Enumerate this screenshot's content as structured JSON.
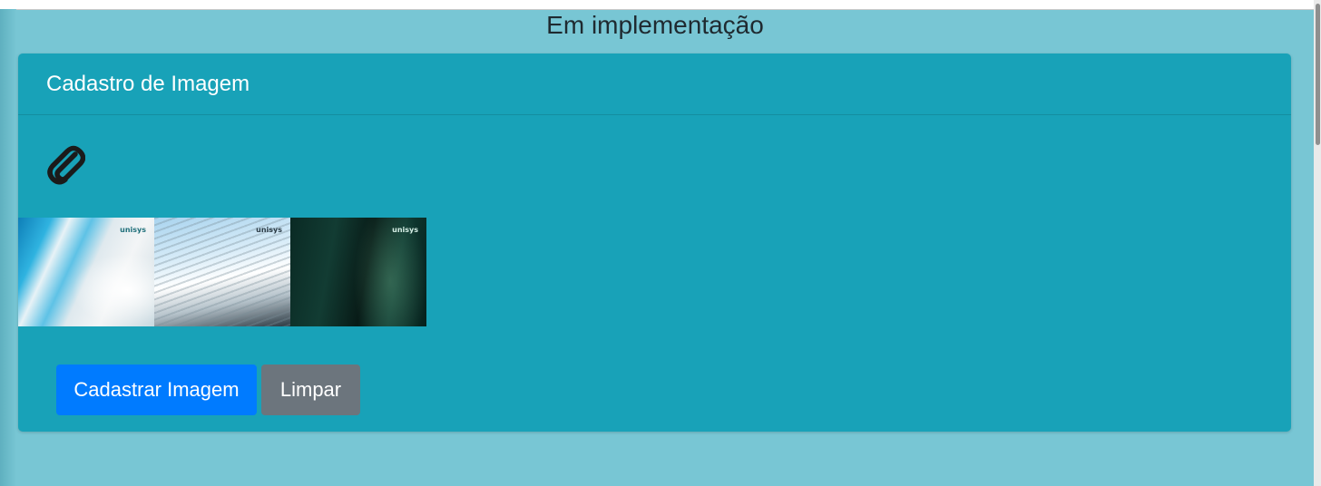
{
  "page": {
    "title": "Em implementação"
  },
  "card": {
    "title": "Cadastro de Imagem",
    "attach_icon": "paperclip-icon",
    "thumbnails": [
      {
        "logo": "unisys"
      },
      {
        "logo": "unisys"
      },
      {
        "logo": "unisys"
      }
    ],
    "buttons": {
      "submit_label": "Cadastrar Imagem",
      "clear_label": "Limpar"
    }
  },
  "colors": {
    "page_background": "#78c6d4",
    "card_background": "#18a2b8",
    "primary_button": "#007bff",
    "secondary_button": "#6c757d"
  }
}
